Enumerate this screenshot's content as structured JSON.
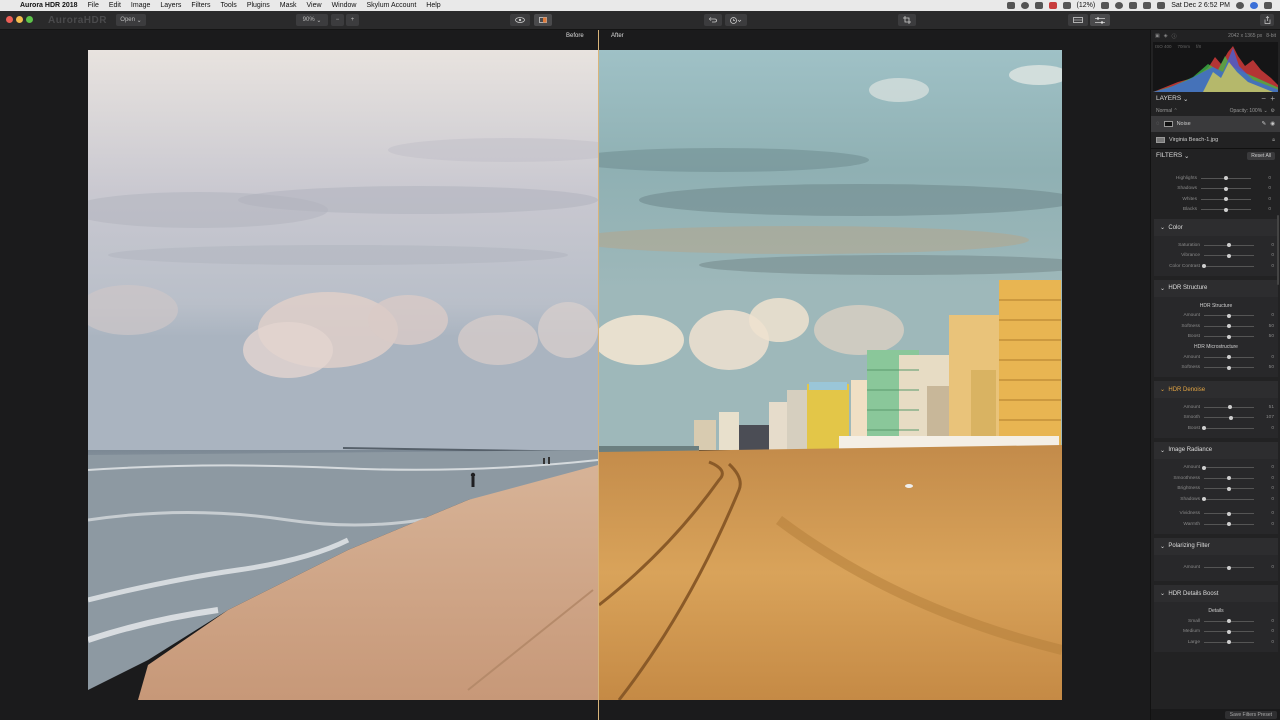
{
  "menubar": {
    "app_name": "Aurora HDR 2018",
    "items": [
      "File",
      "Edit",
      "Image",
      "Layers",
      "Filters",
      "Tools",
      "Plugins",
      "Mask",
      "View",
      "Window",
      "Skylum Account",
      "Help"
    ],
    "battery": "(12%)",
    "clock": "Sat Dec 2  6:52 PM"
  },
  "toolbar": {
    "logo": "AuroraHDR",
    "open_label": "Open",
    "zoom_value": "90%",
    "zoom_out": "−",
    "zoom_in": "+"
  },
  "canvas": {
    "before_label": "Before",
    "after_label": "After"
  },
  "panel": {
    "image_info": "2042 x 1365 px",
    "bit_depth": "8-bit",
    "exif_iso": "ISO 400",
    "exif_focal": "70mm",
    "exif_f": "f/8",
    "layers_title": "LAYERS",
    "blend_mode": "Normal",
    "opacity_label": "Opacity:",
    "opacity_value": "100%",
    "layers": [
      {
        "name": "Noise"
      },
      {
        "name": "Virginia Beach-1.jpg"
      }
    ],
    "filters_title": "FILTERS",
    "reset_all": "Reset All",
    "save_preset": "Save Filters Preset"
  },
  "filters": {
    "tone_rows": [
      {
        "label": "Highlights",
        "value": "0",
        "pos": 0.5
      },
      {
        "label": "Shadows",
        "value": "0",
        "pos": 0.5
      },
      {
        "label": "Whites",
        "value": "0",
        "pos": 0.5
      },
      {
        "label": "Blacks",
        "value": "0",
        "pos": 0.5
      }
    ],
    "color": {
      "title": "Color",
      "rows": [
        {
          "label": "Saturation",
          "value": "0",
          "pos": 0.5
        },
        {
          "label": "Vibrance",
          "value": "0",
          "pos": 0.5
        },
        {
          "label": "Color Contrast",
          "value": "0",
          "pos": 0.0
        }
      ]
    },
    "hdr_structure": {
      "title": "HDR Structure",
      "sub1": "HDR Structure",
      "rows1": [
        {
          "label": "Amount",
          "value": "0",
          "pos": 0.5
        },
        {
          "label": "Softness",
          "value": "50",
          "pos": 0.5
        },
        {
          "label": "Boost",
          "value": "50",
          "pos": 0.5
        }
      ],
      "sub2": "HDR Microstructure",
      "rows2": [
        {
          "label": "Amount",
          "value": "0",
          "pos": 0.5
        },
        {
          "label": "Softness",
          "value": "50",
          "pos": 0.5
        }
      ]
    },
    "hdr_denoise": {
      "title": "HDR Denoise",
      "rows": [
        {
          "label": "Amount",
          "value": "51",
          "pos": 0.51
        },
        {
          "label": "Smooth",
          "value": "107",
          "pos": 0.53
        },
        {
          "label": "Boost",
          "value": "0",
          "pos": 0.0
        }
      ]
    },
    "image_radiance": {
      "title": "Image Radiance",
      "rows": [
        {
          "label": "Amount",
          "value": "0",
          "pos": 0.0
        },
        {
          "label": "Smoothness",
          "value": "0",
          "pos": 0.5
        },
        {
          "label": "Brightness",
          "value": "0",
          "pos": 0.5
        },
        {
          "label": "Shadows",
          "value": "0",
          "pos": 0.0
        }
      ],
      "rows_b": [
        {
          "label": "Vividness",
          "value": "0",
          "pos": 0.5
        },
        {
          "label": "Warmth",
          "value": "0",
          "pos": 0.5
        }
      ]
    },
    "polarizing": {
      "title": "Polarizing Filter",
      "rows": [
        {
          "label": "Amount",
          "value": "0",
          "pos": 0.5
        }
      ]
    },
    "details_boost": {
      "title": "HDR Details Boost",
      "sub": "Details",
      "rows": [
        {
          "label": "Small",
          "value": "0",
          "pos": 0.5
        },
        {
          "label": "Medium",
          "value": "0",
          "pos": 0.5
        },
        {
          "label": "Large",
          "value": "0",
          "pos": 0.5
        }
      ]
    }
  },
  "colors": {
    "accent": "#e3a543",
    "divider": "#d8b47a"
  }
}
